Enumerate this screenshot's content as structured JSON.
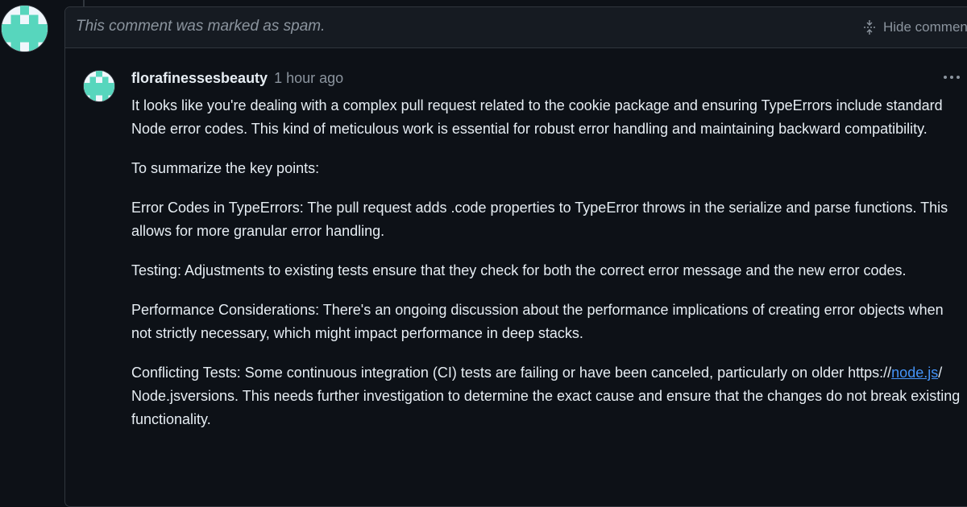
{
  "colors": {
    "background": "#0d1117",
    "header_background": "#161b22",
    "border": "#30363d",
    "text": "#e6edf3",
    "muted": "#8b949e",
    "link": "#4493f8",
    "avatar_teal": "#57d6bd"
  },
  "icons": {
    "hide": "fold-icon",
    "menu": "kebab-horizontal-icon",
    "avatar": "identicon"
  },
  "spam_comment": {
    "notice": "This comment was marked as spam.",
    "hide_label": "Hide comment"
  },
  "comment": {
    "author": "florafinessesbeauty",
    "time": "1 hour ago",
    "paragraphs": [
      "It looks like you're dealing with a complex pull request related to the cookie package and ensuring TypeErrors include standard Node error codes. This kind of meticulous work is essential for robust error handling and maintaining backward compatibility.",
      "To summarize the key points:",
      "Error Codes in TypeErrors: The pull request adds .code properties to TypeError throws in the serialize and parse functions. This allows for more granular error handling.",
      "Testing: Adjustments to existing tests ensure that they check for both the correct error message and the new error codes.",
      "Performance Considerations: There's an ongoing discussion about the performance implications of creating error objects when not strictly necessary, which might impact performance in deep stacks."
    ],
    "last_paragraph": {
      "before_url": "Conflicting Tests: Some continuous integration (CI) tests are failing or have been canceled, particularly on older https://",
      "link_text": "node.js",
      "after_link": "/ Node.jsversions. This needs further investigation to determine the exact cause and ensure that the changes do not break existing functionality."
    }
  }
}
